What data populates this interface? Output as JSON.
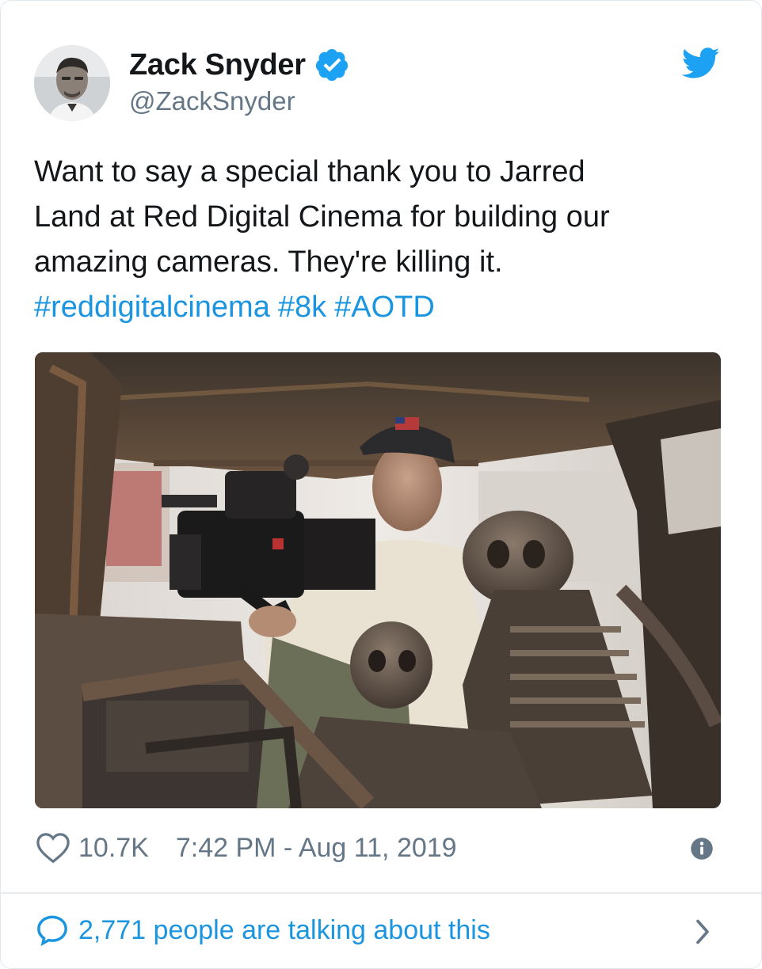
{
  "author": {
    "display_name": "Zack Snyder",
    "handle": "@ZackSnyder",
    "verified": true
  },
  "tweet": {
    "text_lines": [
      "Want to say a special thank you to Jarred",
      "Land at Red Digital Cinema for building our",
      "amazing cameras. They're killing it."
    ],
    "hashtags": [
      "#reddigitalcinema",
      "#8k",
      "#AOTD"
    ]
  },
  "footer": {
    "likes": "10.7K",
    "timestamp": "7:42 PM - Aug 11, 2019",
    "talking": "2,771 people are talking about this"
  },
  "icons": {
    "brand": "twitter-bird-icon",
    "verified": "verified-badge-icon",
    "like": "heart-icon",
    "info": "info-icon",
    "conversation": "speech-bubble-icon",
    "more": "chevron-right-icon"
  },
  "colors": {
    "brand_blue": "#1da1f2",
    "link_blue": "#1b95e0",
    "text": "#14171a",
    "muted": "#657786"
  }
}
